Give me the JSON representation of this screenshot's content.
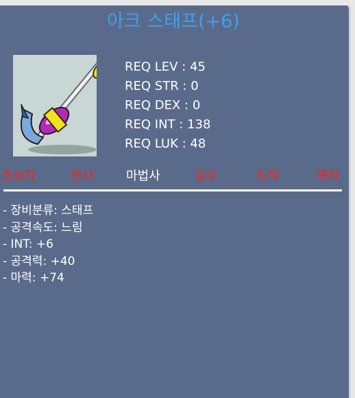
{
  "item": {
    "name": "아크 스태프(+6)",
    "icon": "arc-staff-icon"
  },
  "requirements": [
    "REQ LEV : 45",
    "REQ STR : 0",
    "REQ DEX : 0",
    "REQ INT : 138",
    "REQ LUK : 48"
  ],
  "jobs": [
    {
      "label": "초보자",
      "active": false
    },
    {
      "label": "전사",
      "active": false
    },
    {
      "label": "마법사",
      "active": true
    },
    {
      "label": "궁수",
      "active": false
    },
    {
      "label": "도적",
      "active": false
    },
    {
      "label": "해적",
      "active": false
    }
  ],
  "stats": [
    "- 장비분류: 스태프",
    "- 공격속도: 느림",
    "- INT: +6",
    "- 공격력: +40",
    "- 마력: +74"
  ],
  "colors": {
    "panel": "#5a6a8a",
    "title": "#3f9ff0",
    "job_inactive": "#ff1e1e",
    "job_active": "#ffffff"
  }
}
